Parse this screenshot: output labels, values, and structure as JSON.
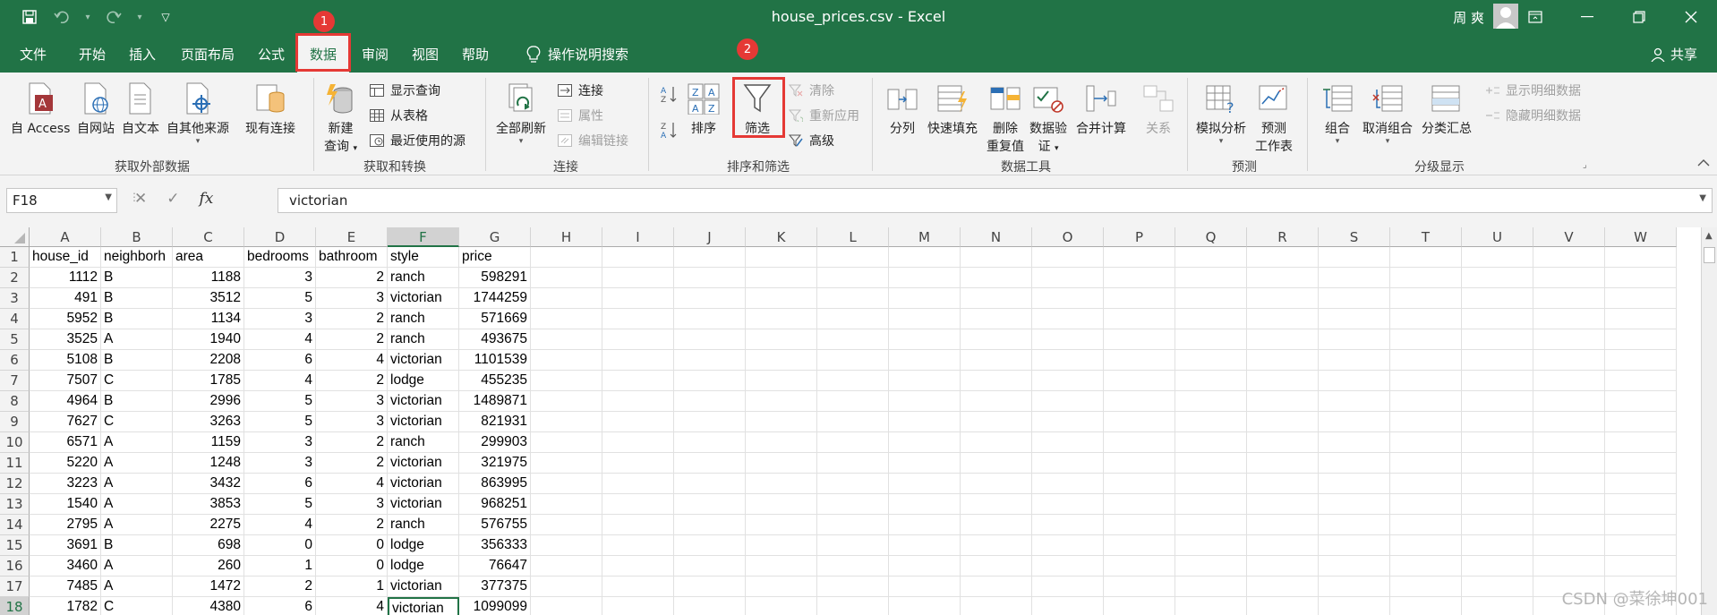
{
  "window": {
    "title": "house_prices.csv  -  Excel",
    "user": "周 爽"
  },
  "tabs": [
    "文件",
    "开始",
    "插入",
    "页面布局",
    "公式",
    "数据",
    "审阅",
    "视图",
    "帮助"
  ],
  "tell_me": "操作说明搜索",
  "share": "共享",
  "badges": [
    "1",
    "2"
  ],
  "ribbon": {
    "get_external": {
      "label": "获取外部数据",
      "buttons": [
        "自 Access",
        "自网站",
        "自文本",
        "自其他来源"
      ]
    },
    "existing_conn": "现有连接",
    "get_transform": {
      "label": "获取和转换",
      "new_query": [
        "新建",
        "查询"
      ],
      "small": [
        "显示查询",
        "从表格",
        "最近使用的源"
      ]
    },
    "connections": {
      "label": "连接",
      "refresh_all": "全部刷新",
      "small": [
        "连接",
        "属性",
        "编辑链接"
      ]
    },
    "sort_filter": {
      "label": "排序和筛选",
      "sort": "排序",
      "filter": "筛选",
      "small": [
        "清除",
        "重新应用",
        "高级"
      ]
    },
    "data_tools": {
      "label": "数据工具",
      "buttons": [
        "分列",
        "快速填充",
        "删除",
        "重复值",
        "数据验",
        "证",
        "合并计算",
        "关系"
      ]
    },
    "forecast": {
      "label": "预测",
      "buttons": [
        "模拟分析",
        "预测",
        "工作表"
      ]
    },
    "outline": {
      "label": "分级显示",
      "buttons": [
        "组合",
        "取消组合",
        "分类汇总"
      ],
      "small": [
        "显示明细数据",
        "隐藏明细数据"
      ]
    }
  },
  "formula_bar": {
    "name_box": "F18",
    "fx": "fx",
    "value": "victorian"
  },
  "columns": [
    "A",
    "B",
    "C",
    "D",
    "E",
    "F",
    "G",
    "H",
    "I",
    "J",
    "K",
    "L",
    "M",
    "N",
    "O",
    "P",
    "Q",
    "R",
    "S",
    "T",
    "U",
    "V",
    "W"
  ],
  "rows": [
    "1",
    "2",
    "3",
    "4",
    "5",
    "6",
    "7",
    "8",
    "9",
    "10",
    "11",
    "12",
    "13",
    "14",
    "15",
    "16",
    "17",
    "18"
  ],
  "header": [
    "house_id",
    "neighborh",
    "area",
    "bedrooms",
    "bathroom",
    "style",
    "price"
  ],
  "data": [
    [
      "1112",
      "B",
      "1188",
      "3",
      "2",
      "ranch",
      "598291"
    ],
    [
      "491",
      "B",
      "3512",
      "5",
      "3",
      "victorian",
      "1744259"
    ],
    [
      "5952",
      "B",
      "1134",
      "3",
      "2",
      "ranch",
      "571669"
    ],
    [
      "3525",
      "A",
      "1940",
      "4",
      "2",
      "ranch",
      "493675"
    ],
    [
      "5108",
      "B",
      "2208",
      "6",
      "4",
      "victorian",
      "1101539"
    ],
    [
      "7507",
      "C",
      "1785",
      "4",
      "2",
      "lodge",
      "455235"
    ],
    [
      "4964",
      "B",
      "2996",
      "5",
      "3",
      "victorian",
      "1489871"
    ],
    [
      "7627",
      "C",
      "3263",
      "5",
      "3",
      "victorian",
      "821931"
    ],
    [
      "6571",
      "A",
      "1159",
      "3",
      "2",
      "ranch",
      "299903"
    ],
    [
      "5220",
      "A",
      "1248",
      "3",
      "2",
      "victorian",
      "321975"
    ],
    [
      "3223",
      "A",
      "3432",
      "6",
      "4",
      "victorian",
      "863995"
    ],
    [
      "1540",
      "A",
      "3853",
      "5",
      "3",
      "victorian",
      "968251"
    ],
    [
      "2795",
      "A",
      "2275",
      "4",
      "2",
      "ranch",
      "576755"
    ],
    [
      "3691",
      "B",
      "698",
      "0",
      "0",
      "lodge",
      "356333"
    ],
    [
      "3460",
      "A",
      "260",
      "1",
      "0",
      "lodge",
      "76647"
    ],
    [
      "7485",
      "A",
      "1472",
      "2",
      "1",
      "victorian",
      "377375"
    ],
    [
      "1782",
      "C",
      "4380",
      "6",
      "4",
      "victorian",
      "1099099"
    ]
  ],
  "watermark": "CSDN @菜徐坤001"
}
